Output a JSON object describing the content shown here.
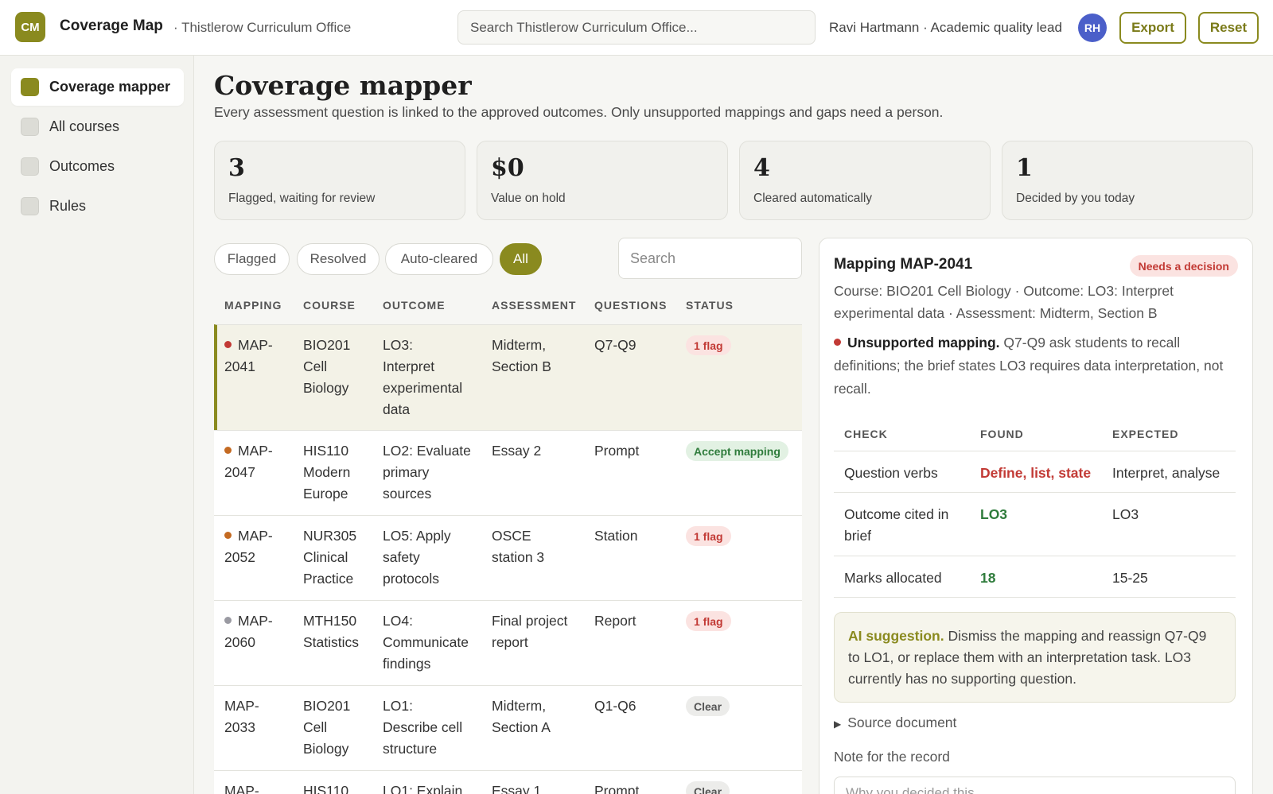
{
  "app": {
    "logo": "CM",
    "title": "Coverage Map",
    "org": "· Thistlerow Curriculum Office"
  },
  "top_search": {
    "placeholder": "Search Thistlerow Curriculum Office..."
  },
  "user": {
    "label": "Ravi Hartmann · Academic quality lead",
    "initials": "RH"
  },
  "toolbar": {
    "export_label": "Export",
    "reset_label": "Reset"
  },
  "sidebar": {
    "items": [
      {
        "label": "Coverage mapper",
        "active": true
      },
      {
        "label": "All courses",
        "active": false
      },
      {
        "label": "Outcomes",
        "active": false
      },
      {
        "label": "Rules",
        "active": false
      }
    ]
  },
  "page": {
    "title": "Coverage mapper",
    "subtitle": "Every assessment question is linked to the approved outcomes. Only unsupported mappings and gaps need a person."
  },
  "stats": [
    {
      "value": "3",
      "label": "Flagged, waiting for review"
    },
    {
      "value": "$0",
      "label": "Value on hold"
    },
    {
      "value": "4",
      "label": "Cleared automatically"
    },
    {
      "value": "1",
      "label": "Decided by you today"
    }
  ],
  "filters": {
    "items": [
      "Flagged",
      "Resolved",
      "Auto-cleared",
      "All"
    ],
    "active": "All",
    "search_placeholder": "Search"
  },
  "table": {
    "headers": [
      "MAPPING",
      "COURSE",
      "OUTCOME",
      "ASSESSMENT",
      "QUESTIONS",
      "STATUS"
    ],
    "rows": [
      {
        "id": "MAP-\n2041",
        "dot": "#c23a35",
        "course": "BIO201\nCell\nBiology",
        "outcome": "LO3:\nInterpret\nexperimental\ndata",
        "assessment": "Midterm,\nSection B",
        "questions": "Q7-Q9",
        "status": "1 flag",
        "status_kind": "flag"
      },
      {
        "id": "MAP-\n2047",
        "dot": "#c46a22",
        "course": "HIS110\nModern\nEurope",
        "outcome": "LO2: Evaluate\nprimary\nsources",
        "assessment": "Essay 2",
        "questions": "Prompt",
        "status": "Accept mapping",
        "status_kind": "accept"
      },
      {
        "id": "MAP-\n2052",
        "dot": "#c46a22",
        "course": "NUR305\nClinical\nPractice",
        "outcome": "LO5: Apply\nsafety\nprotocols",
        "assessment": "OSCE\nstation 3",
        "questions": "Station",
        "status": "1 flag",
        "status_kind": "flag"
      },
      {
        "id": "MAP-\n2060",
        "dot": "#9a9aa2",
        "course": "MTH150\nStatistics",
        "outcome": "LO4:\nCommunicate\nfindings",
        "assessment": "Final project\nreport",
        "questions": "Report",
        "status": "1 flag",
        "status_kind": "flag"
      },
      {
        "id": "MAP-\n2033",
        "dot": "",
        "course": "BIO201\nCell\nBiology",
        "outcome": "LO1:\nDescribe cell\nstructure",
        "assessment": "Midterm,\nSection A",
        "questions": "Q1-Q6",
        "status": "Clear",
        "status_kind": "clear"
      },
      {
        "id": "MAP-",
        "dot": "",
        "course": "HIS110",
        "outcome": "LO1: Explain",
        "assessment": "Essay 1",
        "questions": "Prompt",
        "status": "Clear",
        "status_kind": "clear"
      }
    ]
  },
  "detail": {
    "title": "Mapping MAP-2041",
    "badge": "Needs a decision",
    "meta": "Course: BIO201 Cell Biology · Outcome: LO3: Interpret experimental data · Assessment: Midterm, Section B",
    "finding_label": "Unsupported mapping.",
    "finding_text": "Q7-Q9 ask students to recall definitions; the brief states LO3 requires data interpretation, not recall.",
    "checks_headers": [
      "CHECK",
      "FOUND",
      "EXPECTED"
    ],
    "checks": [
      {
        "check": "Question verbs",
        "found": "Define, list, state",
        "found_ok": false,
        "expected": "Interpret, analyse"
      },
      {
        "check": "Outcome cited in brief",
        "found": "LO3",
        "found_ok": true,
        "expected": "LO3"
      },
      {
        "check": "Marks allocated",
        "found": "18",
        "found_ok": true,
        "expected": "15-25"
      }
    ],
    "ai_label": "AI suggestion.",
    "ai_text": "Dismiss the mapping and reassign Q7-Q9 to LO1, or replace them with an interpretation task. LO3 currently has no supporting question.",
    "source_label": "Source document",
    "note_label": "Note for the record",
    "note_placeholder": "Why you decided this"
  }
}
